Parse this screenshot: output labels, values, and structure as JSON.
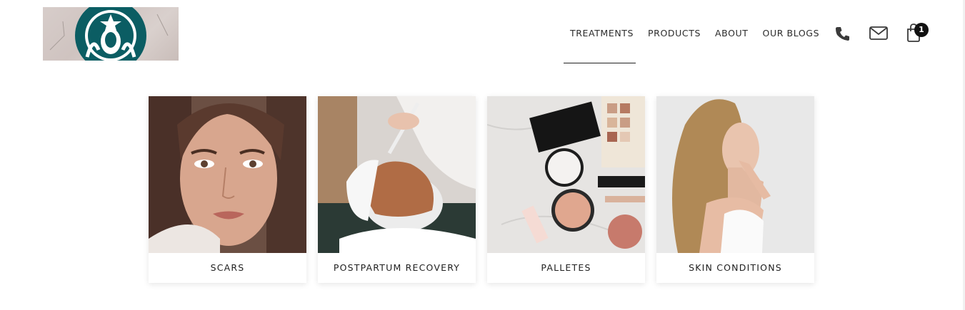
{
  "header": {
    "logo_icon": "starbucks-siren-logo",
    "nav": [
      {
        "label": "TREATMENTS",
        "active": true
      },
      {
        "label": "PRODUCTS"
      },
      {
        "label": "ABOUT"
      },
      {
        "label": "OUR BLOGS"
      }
    ],
    "icons": {
      "phone": "phone-icon",
      "mail": "mail-icon",
      "cart": "shopping-bag-icon"
    },
    "cart_count": "1"
  },
  "categories": [
    {
      "label": "SCARS",
      "image": "woman-portrait-photo"
    },
    {
      "label": "POSTPARTUM RECOVERY",
      "image": "facial-mask-treatment-photo"
    },
    {
      "label": "PALLETES",
      "image": "makeup-palette-flatlay-photo"
    },
    {
      "label": "SKIN CONDITIONS",
      "image": "woman-profile-photo"
    }
  ],
  "colors": {
    "logo_green": "#00704a",
    "logo_teal": "#0b5d63",
    "text": "#222222",
    "badge": "#111111"
  }
}
